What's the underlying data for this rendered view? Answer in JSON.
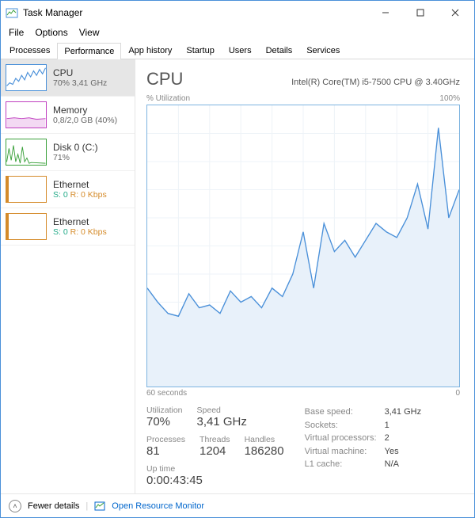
{
  "window": {
    "title": "Task Manager"
  },
  "menu": {
    "file": "File",
    "options": "Options",
    "view": "View"
  },
  "tabs": {
    "processes": "Processes",
    "performance": "Performance",
    "app_history": "App history",
    "startup": "Startup",
    "users": "Users",
    "details": "Details",
    "services": "Services"
  },
  "sidebar": [
    {
      "name": "CPU",
      "stat": "70% 3,41 GHz",
      "color": "#4a90d9",
      "selected": true
    },
    {
      "name": "Memory",
      "stat": "0,8/2,0 GB (40%)",
      "color": "#c040c0"
    },
    {
      "name": "Disk 0 (C:)",
      "stat": "71%",
      "color": "#3aa03a"
    },
    {
      "name": "Ethernet",
      "sr": {
        "s": "S: 0",
        "r": "R: 0 Kbps"
      },
      "color": "#d58b2a"
    },
    {
      "name": "Ethernet",
      "sr": {
        "s": "S: 0",
        "r": "R: 0 Kbps"
      },
      "color": "#d58b2a"
    }
  ],
  "main": {
    "title": "CPU",
    "model": "Intel(R) Core(TM) i5-7500 CPU @ 3.40GHz",
    "scale_top_left": "% Utilization",
    "scale_top_right": "100%",
    "scale_bottom_left": "60 seconds",
    "scale_bottom_right": "0"
  },
  "stats": {
    "utilization": {
      "lbl": "Utilization",
      "val": "70%"
    },
    "speed": {
      "lbl": "Speed",
      "val": "3,41 GHz"
    },
    "processes": {
      "lbl": "Processes",
      "val": "81"
    },
    "threads": {
      "lbl": "Threads",
      "val": "1204"
    },
    "handles": {
      "lbl": "Handles",
      "val": "186280"
    },
    "uptime": {
      "lbl": "Up time",
      "val": "0:00:43:45"
    }
  },
  "details": {
    "base_speed": {
      "k": "Base speed:",
      "v": "3,41 GHz"
    },
    "sockets": {
      "k": "Sockets:",
      "v": "1"
    },
    "vprocs": {
      "k": "Virtual processors:",
      "v": "2"
    },
    "vm": {
      "k": "Virtual machine:",
      "v": "Yes"
    },
    "l1": {
      "k": "L1 cache:",
      "v": "N/A"
    }
  },
  "footer": {
    "fewer": "Fewer details",
    "orm": "Open Resource Monitor"
  },
  "chart_data": {
    "type": "line",
    "title": "CPU % Utilization",
    "xlabel": "60 seconds → 0",
    "ylabel": "% Utilization",
    "ylim": [
      0,
      100
    ],
    "x_seconds_ago": [
      60,
      58,
      56,
      54,
      52,
      50,
      48,
      46,
      44,
      42,
      40,
      38,
      36,
      34,
      32,
      30,
      28,
      26,
      24,
      22,
      20,
      18,
      16,
      14,
      12,
      10,
      8,
      6,
      4,
      2,
      0
    ],
    "values": [
      35,
      30,
      26,
      25,
      33,
      28,
      29,
      26,
      34,
      30,
      32,
      28,
      35,
      32,
      40,
      55,
      35,
      58,
      48,
      52,
      46,
      52,
      58,
      55,
      53,
      60,
      72,
      56,
      92,
      60,
      70
    ]
  }
}
